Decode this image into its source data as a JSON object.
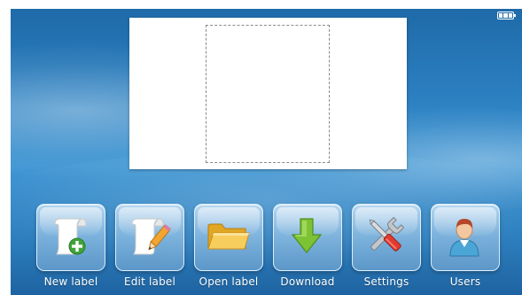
{
  "status": {
    "battery_level": 1.0
  },
  "toolbar": {
    "items": [
      {
        "label": "New label",
        "icon": "new-label-icon"
      },
      {
        "label": "Edit label",
        "icon": "edit-label-icon"
      },
      {
        "label": "Open label",
        "icon": "folder-icon"
      },
      {
        "label": "Download",
        "icon": "download-arrow-icon"
      },
      {
        "label": "Settings",
        "icon": "tools-icon"
      },
      {
        "label": "Users",
        "icon": "user-icon"
      }
    ]
  },
  "colors": {
    "background": "#2b7fc0",
    "add_badge": "#3fa33a",
    "download_arrow": "#7dc234",
    "folder": "#f2c04a",
    "user_shirt": "#4aa6d6"
  }
}
